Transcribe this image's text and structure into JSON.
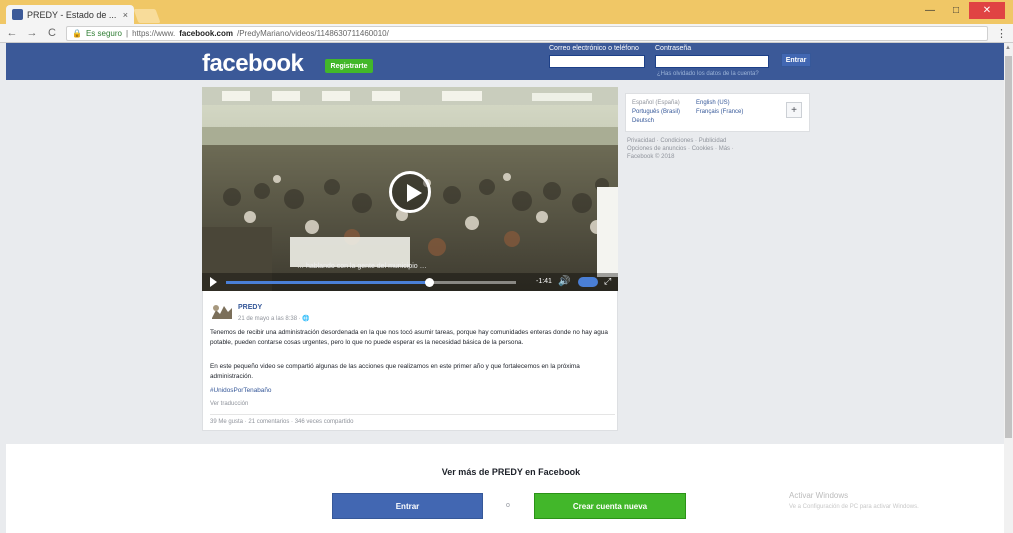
{
  "browser": {
    "tab_title": "PREDY - Estado de ... ",
    "tab_close": "×",
    "url_secure": "Es seguro",
    "url_prefix": "https://www.",
    "url_domain": "facebook.com",
    "url_path": "/PredyMariano/videos/1148630711460010/",
    "menu": "⋮",
    "win_min": "—",
    "win_max": "□",
    "win_close": "✕",
    "back": "←",
    "forward": "→",
    "reload": "C"
  },
  "header": {
    "logo": "facebook",
    "register": "Registrarte",
    "email_label": "Correo electrónico o teléfono",
    "password_label": "Contraseña",
    "forgot": "¿Has olvidado los datos de la cuenta?",
    "login": "Entrar"
  },
  "video": {
    "caption": "… hablando con la gente del municipio …",
    "time": "-1:41",
    "progress_fraction": 0.7,
    "volume_icon": "🔊",
    "fullscreen_icon": "⤢"
  },
  "post": {
    "author": "PREDY",
    "date": "21 de mayo a las 8:38 · 🌐",
    "para1": "Tenemos de recibir una administración desordenada en la que nos tocó asumir tareas, porque hay comunidades enteras donde no hay agua potable, pueden contarse cosas urgentes, pero lo que no puede esperar es la necesidad básica de la persona.",
    "para2": "En este pequeño video se compartió algunas de las acciones que realizamos en este primer año y que fortalecemos en la próxima administración.",
    "hashtag": "#UnidosPorTenabaño",
    "translate": "Ver traducción",
    "stats": "39 Me gusta · 21 comentarios · 346 veces compartido"
  },
  "sidebar": {
    "languages": [
      "Español (España)",
      "English (US)",
      "Português (Brasil)",
      "Français (France)",
      "Deutsch"
    ],
    "plus": "+",
    "footer1": "Privacidad · Condiciones · Publicidad",
    "footer2": "Opciones de anuncios · Cookies · Más ·",
    "footer3": "Facebook © 2018"
  },
  "bottom": {
    "see_more": "Ver más de PREDY en Facebook",
    "login": "Entrar",
    "or": "o",
    "create": "Crear cuenta nueva",
    "activate": "Activar Windows",
    "activate_sub": "Ve a Configuración de PC para activar Windows."
  },
  "colors": {
    "fb_blue": "#3b5998",
    "button_blue": "#4267b2",
    "green": "#42b72a",
    "chrome_title": "#f0c766"
  }
}
